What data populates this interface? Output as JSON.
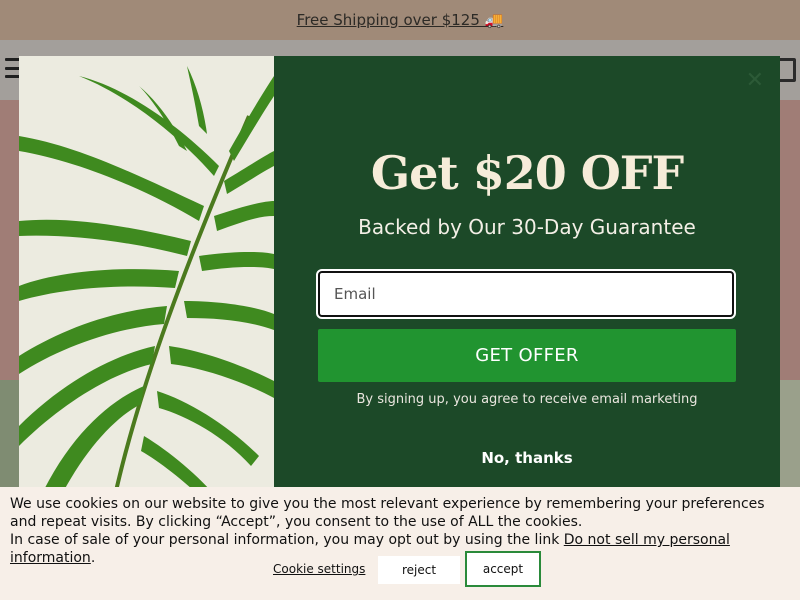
{
  "announcement": {
    "text": "Free Shipping over $125 🚚"
  },
  "header": {
    "menu_icon": "hamburger-icon",
    "cart_icon": "cart-icon"
  },
  "modal": {
    "close_icon": "close-icon",
    "headline": "Get $20 OFF",
    "subheadline": "Backed by Our 30-Day Guarantee",
    "email_placeholder": "Email",
    "cta_label": "GET OFFER",
    "consent_text": "By signing up, you agree to receive email marketing",
    "decline_label": "No, thanks",
    "image": "palm-leaf-photo",
    "colors": {
      "panel_bg": "#1c4928",
      "cta_bg": "#219430",
      "headline": "#f6ecd9"
    }
  },
  "cookie_banner": {
    "line1": "We use cookies on our website to give you the most relevant experience by remembering your preferences and repeat visits. By clicking “Accept”, you consent to the use of ALL the cookies.",
    "line2_prefix": "In case of sale of your personal information, you may opt out by using the link ",
    "line2_link": "Do not sell my personal information",
    "line2_suffix": ".",
    "settings_label": "Cookie settings",
    "reject_label": "reject",
    "accept_label": "accept",
    "colors": {
      "bg": "#f7efe8",
      "accept_border": "#2a8a3a"
    }
  }
}
